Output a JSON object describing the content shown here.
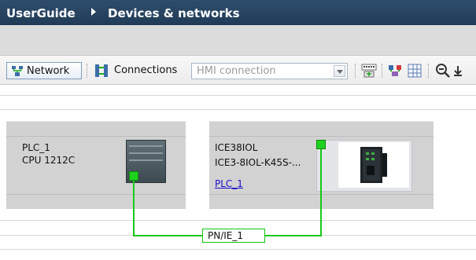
{
  "breadcrumb": {
    "root": "UserGuide",
    "current": "Devices & networks"
  },
  "toolbar": {
    "network_label": "Network",
    "connections_label": "Connections",
    "connection_type_value": "HMI connection"
  },
  "devices": [
    {
      "name": "PLC_1",
      "type": "CPU 1212C"
    },
    {
      "name": "ICE38IOL",
      "type": "ICE3-8IOL-K45S-...",
      "controller_link": "PLC_1"
    }
  ],
  "network": {
    "subnet_label": "PN/IE_1",
    "color": "#19c819"
  }
}
